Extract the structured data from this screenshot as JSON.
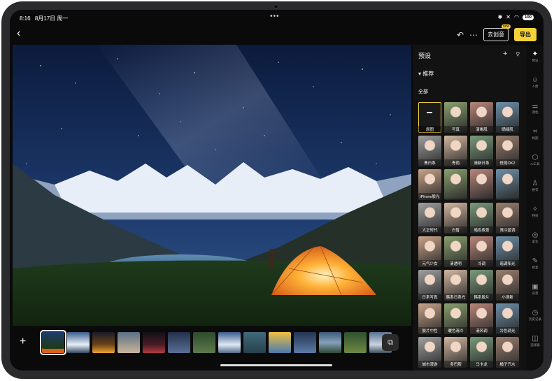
{
  "status": {
    "time": "8:16",
    "date": "8月17日 周一",
    "battery": "100"
  },
  "toolbar": {
    "back": "‹",
    "undo": "↶",
    "more": "⋯",
    "go_create": "去创意",
    "go_create_tag": "new",
    "export": "导出"
  },
  "filmstrip": {
    "add": "+",
    "thumb_count": 14
  },
  "panel": {
    "title": "预设",
    "add": "+",
    "filter": "▿",
    "section": "▾ 推荐",
    "filter_all": "全部",
    "presets": [
      "原图",
      "写真",
      "清晰肌",
      "晒绿肌",
      "黑白系",
      "青雨",
      "清新日系",
      "低饱OK2",
      "iPhone胶光",
      "",
      "",
      "",
      "大正时代",
      "白皙",
      "暗色夜景",
      "清冷蓝调",
      "元气少女",
      "清透明",
      "冷调",
      "暗调阳光",
      "日系写真",
      "韩系日系光",
      "韩系胶片",
      "小清新",
      "胶片中性",
      "暖色清冷",
      "港风调",
      "冷色调光",
      "城市漫游",
      "多巴胺",
      "马卡龙",
      "橘子汽水"
    ]
  },
  "rail": [
    {
      "icon": "✦",
      "label": "预设"
    },
    {
      "icon": "☺",
      "label": "人像"
    },
    {
      "icon": "⚌",
      "label": "调色"
    },
    {
      "icon": "⌗",
      "label": "构图"
    },
    {
      "icon": "⬡",
      "label": "AI工具"
    },
    {
      "icon": "♙",
      "label": "换衣"
    },
    {
      "icon": "✧",
      "label": "特效"
    },
    {
      "icon": "◎",
      "label": "美化"
    },
    {
      "icon": "✎",
      "label": "修复"
    },
    {
      "icon": "▣",
      "label": "背景"
    },
    {
      "icon": "◷",
      "label": "历史记录"
    },
    {
      "icon": "◫",
      "label": "选择器"
    }
  ],
  "colors": {
    "accent": "#f5d23a",
    "background": "#0a0a0a"
  }
}
